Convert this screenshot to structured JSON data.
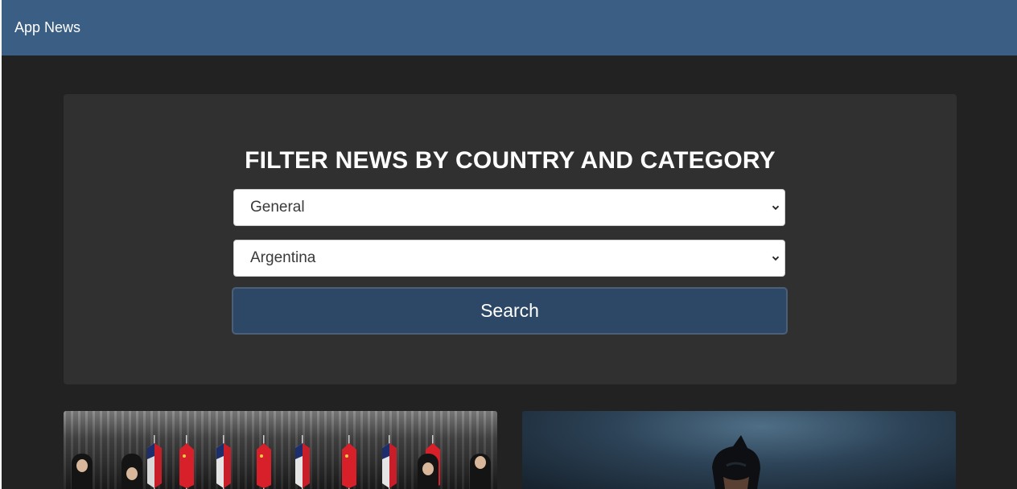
{
  "navbar": {
    "brand": "App News"
  },
  "filter": {
    "title": "FILTER NEWS BY COUNTRY AND CATEGORY",
    "category_selected": "General",
    "country_selected": "Argentina",
    "search_label": "Search"
  },
  "colors": {
    "navbar_bg": "#3a5e84",
    "page_bg": "#222222",
    "panel_bg": "#303030",
    "button_bg": "#2c4866"
  },
  "icons": {
    "select_arrow": "chevron-down-icon"
  }
}
